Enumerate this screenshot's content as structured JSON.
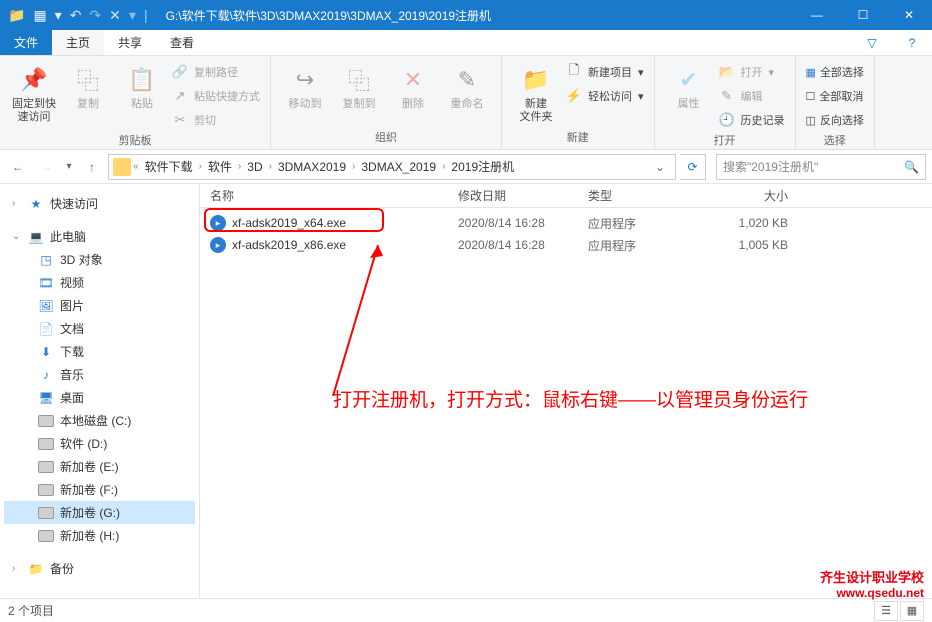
{
  "titlebar": {
    "path": "G:\\软件下载\\软件\\3D\\3DMAX2019\\3DMAX_2019\\2019注册机"
  },
  "tabs": {
    "file": "文件",
    "home": "主页",
    "share": "共享",
    "view": "查看"
  },
  "ribbon": {
    "pin": "固定到快\n速访问",
    "copy": "复制",
    "paste": "粘贴",
    "copypath": "复制路径",
    "pasteshortcut": "粘贴快捷方式",
    "cut": "剪切",
    "clipboard_label": "剪贴板",
    "moveto": "移动到",
    "copyto": "复制到",
    "delete": "删除",
    "rename": "重命名",
    "organize_label": "组织",
    "newfolder": "新建\n文件夹",
    "newitem": "新建项目",
    "easyaccess": "轻松访问",
    "new_label": "新建",
    "properties": "属性",
    "open": "打开",
    "edit": "编辑",
    "history": "历史记录",
    "open_label": "打开",
    "selectall": "全部选择",
    "selectnone": "全部取消",
    "invertsel": "反向选择",
    "select_label": "选择"
  },
  "breadcrumb": {
    "items": [
      "软件下载",
      "软件",
      "3D",
      "3DMAX2019",
      "3DMAX_2019",
      "2019注册机"
    ]
  },
  "search": {
    "placeholder": "搜索\"2019注册机\""
  },
  "tree": {
    "quickaccess": "快速访问",
    "thispc": "此电脑",
    "objects3d": "3D 对象",
    "videos": "视频",
    "pictures": "图片",
    "documents": "文档",
    "downloads": "下载",
    "music": "音乐",
    "desktop": "桌面",
    "localdisk_c": "本地磁盘 (C:)",
    "soft_d": "软件 (D:)",
    "vol_e": "新加卷 (E:)",
    "vol_f": "新加卷 (F:)",
    "vol_g": "新加卷 (G:)",
    "vol_h": "新加卷 (H:)",
    "backup": "备份"
  },
  "columns": {
    "name": "名称",
    "date": "修改日期",
    "type": "类型",
    "size": "大小"
  },
  "files": [
    {
      "name": "xf-adsk2019_x64.exe",
      "date": "2020/8/14 16:28",
      "type": "应用程序",
      "size": "1,020 KB"
    },
    {
      "name": "xf-adsk2019_x86.exe",
      "date": "2020/8/14 16:28",
      "type": "应用程序",
      "size": "1,005 KB"
    }
  ],
  "status": {
    "count": "2 个项目"
  },
  "annotation": {
    "text": "打开注册机，打开方式：鼠标右键——以管理员身份运行"
  },
  "watermark": {
    "line1": "齐生设计职业学校",
    "line2": "www.qsedu.net"
  }
}
